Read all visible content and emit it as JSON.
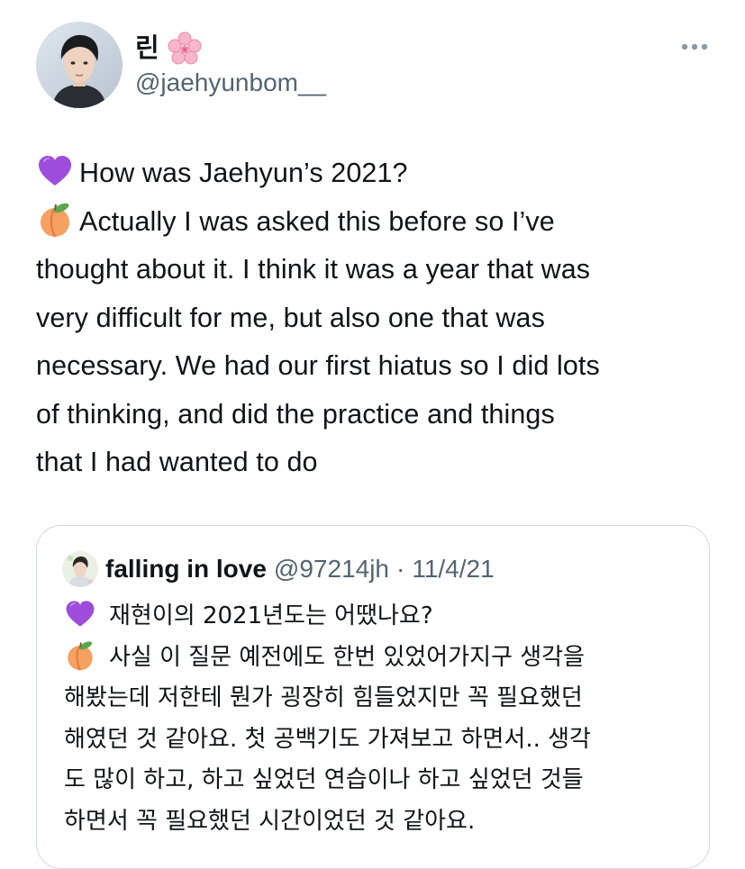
{
  "author": {
    "display_name": "린",
    "handle": "@jaehyunbom__",
    "name_emoji_icon": "cherry-blossom-icon",
    "avatar_icon": "profile-photo"
  },
  "more_icon": "ellipsis-icon",
  "tweet": {
    "lines": [
      {
        "emoji": "purple-heart-icon",
        "text": "How was Jaehyun’s 2021?"
      },
      {
        "emoji": "peach-icon",
        "text": "Actually I was asked this before so I’ve"
      },
      {
        "emoji": null,
        "text": "thought about it. I think it was a year that was"
      },
      {
        "emoji": null,
        "text": "very difficult for me, but also one that was"
      },
      {
        "emoji": null,
        "text": "necessary. We had our first hiatus so I did lots"
      },
      {
        "emoji": null,
        "text": "of thinking, and did the practice and things"
      },
      {
        "emoji": null,
        "text": "that I had wanted to do"
      }
    ]
  },
  "quote": {
    "display_name": "falling in love",
    "handle": "@97214jh",
    "separator": "·",
    "date": "11/4/21",
    "lines": [
      {
        "emoji": "purple-heart-icon",
        "text": "재현이의 2021년도는 어땠나요?"
      },
      {
        "emoji": "peach-icon",
        "text": "사실 이 질문 예전에도 한번 있었어가지구 생각을"
      },
      {
        "emoji": null,
        "text": "해봤는데 저한테 뭔가 굉장히 힘들었지만 꼭 필요했던"
      },
      {
        "emoji": null,
        "text": "해였던 것 같아요. 첫 공백기도 가져보고 하면서.. 생각"
      },
      {
        "emoji": null,
        "text": "도 많이 하고, 하고 싶었던 연습이나 하고 싶었던 것들"
      },
      {
        "emoji": null,
        "text": "하면서 꼭 필요했던 시간이었던 것 같아요."
      }
    ]
  }
}
